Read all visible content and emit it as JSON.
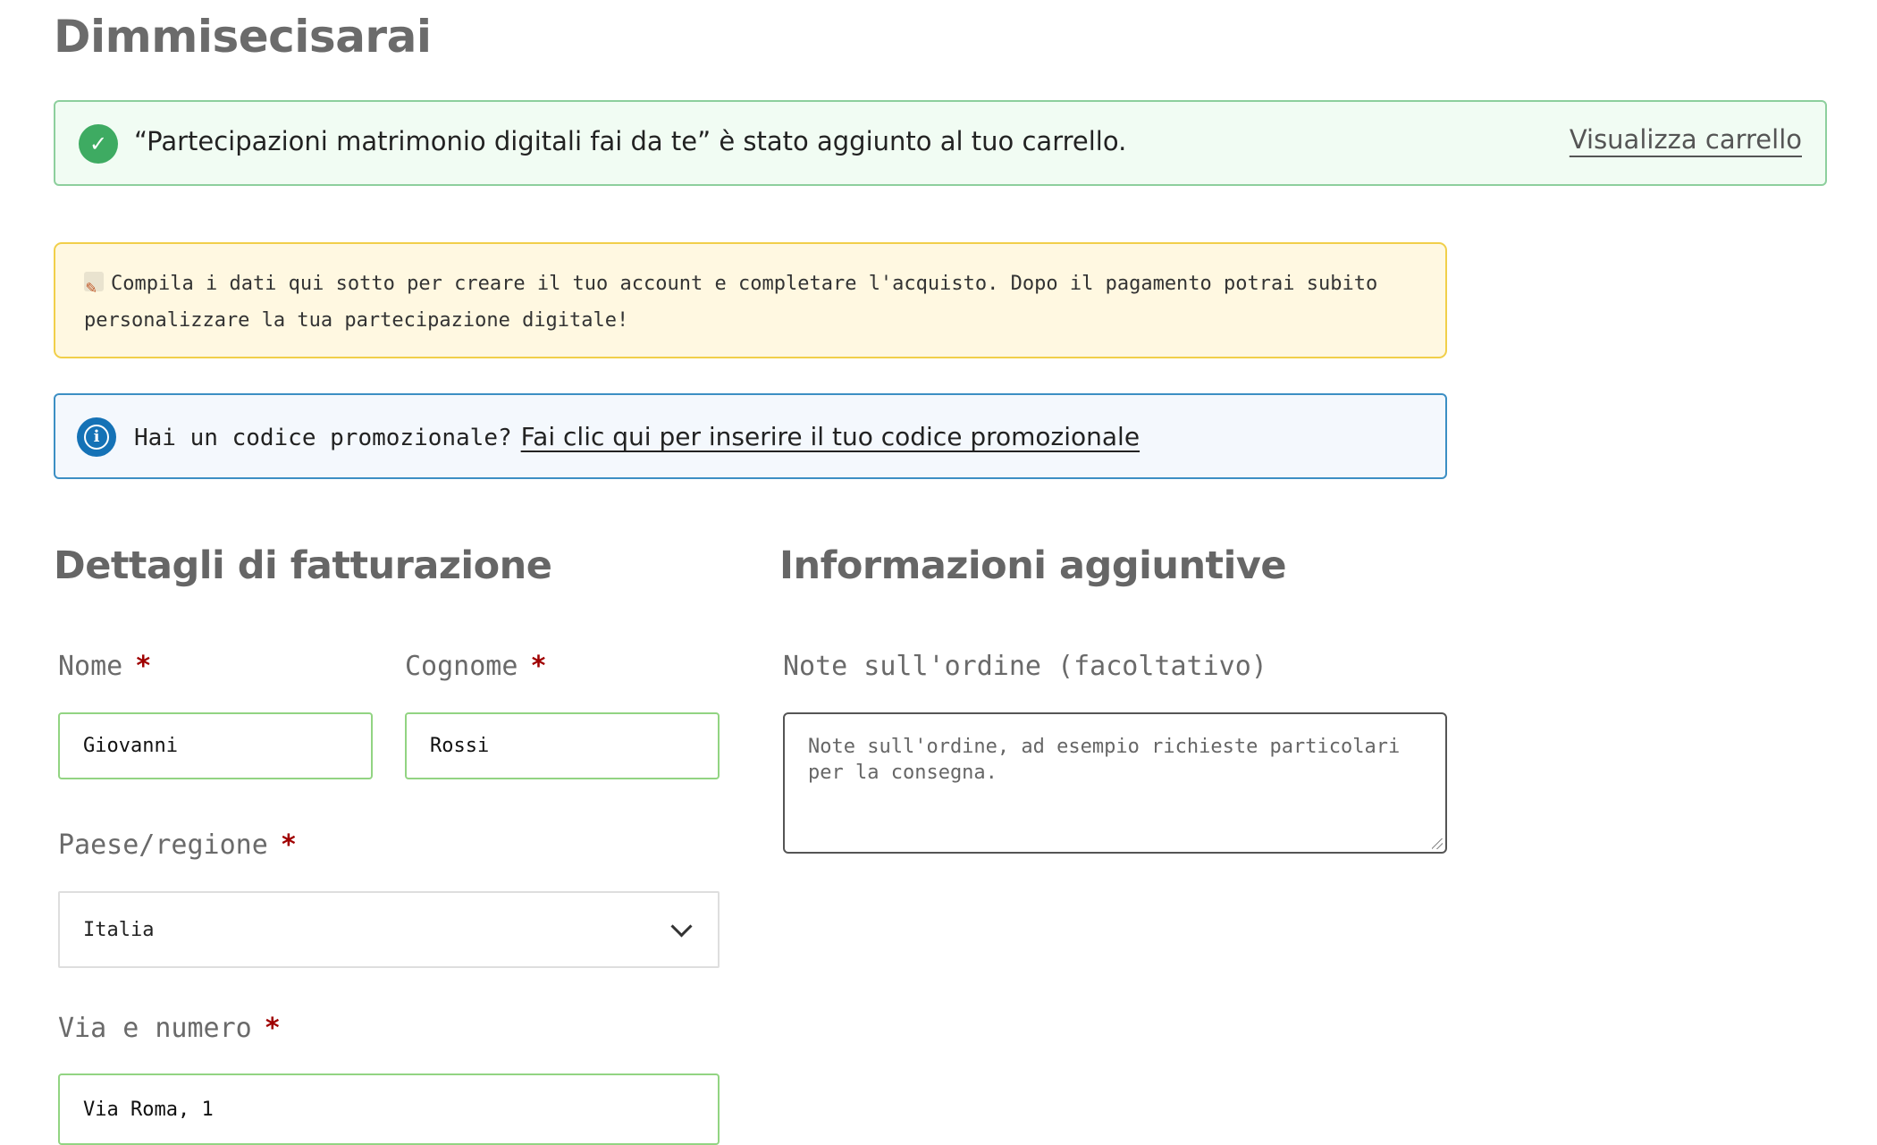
{
  "page": {
    "title": "Dimmisecisarai"
  },
  "notices": {
    "success": {
      "message": "“Partecipazioni matrimonio digitali fai da te” è stato aggiunto al tuo carrello.",
      "view_cart": "Visualizza carrello",
      "icon": "check-circle-icon",
      "color": "#3eab62"
    },
    "warning": {
      "icon": "memo-pencil-icon",
      "message": "Compila i dati qui sotto per creare il tuo account e completare l'acquisto. Dopo il pagamento potrai subito personalizzare la tua partecipazione digitale!",
      "color": "#f1cf4a"
    },
    "coupon": {
      "icon": "info-circle-icon",
      "question": "Hai un codice promozionale?",
      "link": "Fai clic qui per inserire il tuo codice promozionale",
      "color": "#1572b6"
    }
  },
  "billing": {
    "title": "Dettagli di fatturazione",
    "required_marker": "*",
    "first_name": {
      "label": "Nome",
      "value": "Giovanni"
    },
    "last_name": {
      "label": "Cognome",
      "value": "Rossi"
    },
    "country": {
      "label": "Paese/regione",
      "value": "Italia"
    },
    "address": {
      "label": "Via e numero",
      "value": "Via Roma, 1"
    }
  },
  "additional": {
    "title": "Informazioni aggiuntive",
    "notes": {
      "label": "Note sull'ordine (facoltativo)",
      "placeholder": "Note sull'ordine, ad esempio richieste particolari per la consegna."
    }
  }
}
